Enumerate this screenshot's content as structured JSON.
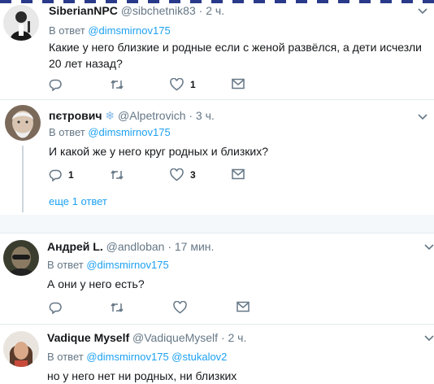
{
  "tweets": [
    {
      "name": "SiberianNPC",
      "handle": "@sibchetnik83",
      "time": "· 2 ч.",
      "reply_prefix": "В ответ",
      "mentions": [
        "@dimsmirnov175"
      ],
      "text": "Какие у него близкие и родные если с женой развёлся, а дети исчезли 20 лет назад?",
      "reply_count": "",
      "retweet_count": "",
      "like_count": "1"
    },
    {
      "name": "пєтрович",
      "badge": "❄",
      "handle": "@Alpetrovich",
      "time": "· 3 ч.",
      "reply_prefix": "В ответ",
      "mentions": [
        "@dimsmirnov175"
      ],
      "text": "И какой же у него круг родных и близких?",
      "reply_count": "1",
      "retweet_count": "",
      "like_count": "3"
    },
    {
      "name": "Андрей L.",
      "handle": "@andloban",
      "time": "· 17 мин.",
      "reply_prefix": "В ответ",
      "mentions": [
        "@dimsmirnov175"
      ],
      "text": "А они у него есть?",
      "reply_count": "",
      "retweet_count": "",
      "like_count": ""
    },
    {
      "name": "Vadique Myself",
      "handle": "@VadiqueMyself",
      "time": "· 2 ч.",
      "reply_prefix": "В ответ",
      "mentions": [
        "@dimsmirnov175",
        "@stukalov2"
      ],
      "text": "но у него нет ни родных, ни близких"
    }
  ],
  "more_replies": "еще 1 ответ",
  "icons": {
    "reply": "reply-icon",
    "retweet": "retweet-icon",
    "like": "heart-icon",
    "dm": "envelope-icon",
    "menu": "chevron-down-icon"
  },
  "colors": {
    "link": "#1da1f2",
    "secondary": "#657786",
    "divider": "#e6ecf0",
    "thread_line": "#ccd6dd"
  }
}
